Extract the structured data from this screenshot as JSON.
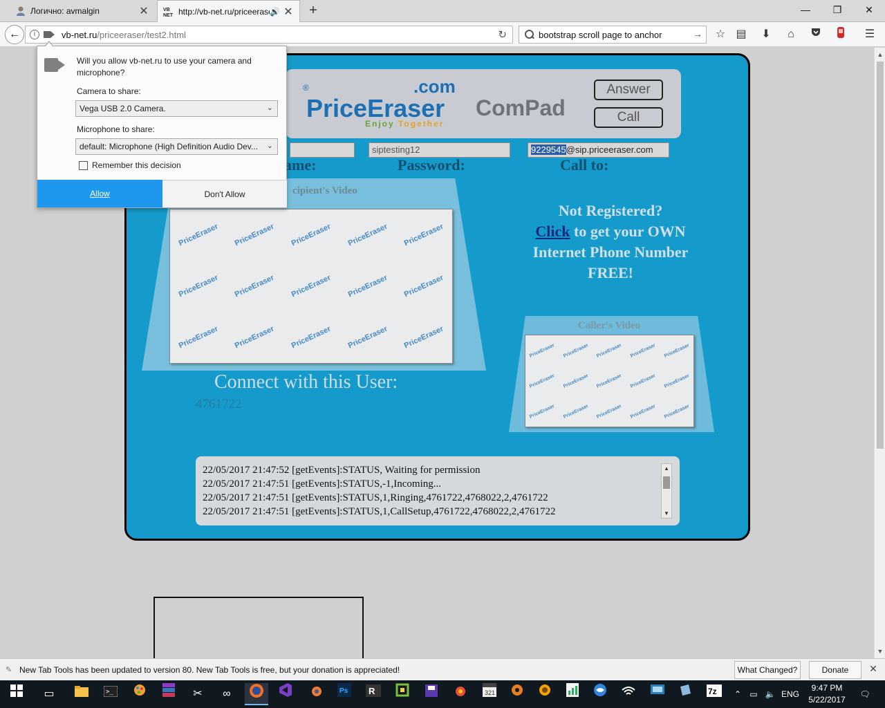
{
  "browser": {
    "tabs": [
      {
        "title": "Логично: avmalgin",
        "favicon": "user-icon"
      },
      {
        "title": "http://vb-net.ru/priceeraser",
        "favicon": "vb-net-icon",
        "audio": "speaker-icon"
      }
    ],
    "url_domain": "vb-net.ru",
    "url_path": "/priceeraser/test2.html",
    "search_query": "bootstrap scroll page to anchor",
    "window_controls": {
      "minimize": "—",
      "restore": "❐",
      "close": "✕"
    }
  },
  "page": {
    "logo": {
      "registered": "®",
      "brand": "PriceEraser",
      "com": ".com",
      "tagline_1": "Enjoy",
      "tagline_2": "Together"
    },
    "compad": "ComPad",
    "answer_label": "Answer",
    "call_label": "Call",
    "password_value": "siptesting12",
    "call_to_selected": "9229545",
    "call_to_rest": "@sip.priceeraser.com",
    "label_username": "ame:",
    "label_password": "Password:",
    "label_callto": "Call to:",
    "recipient_video_label": "cipient's Video",
    "caller_video_label": "Caller's Video",
    "video_watermark": "PriceEraser",
    "connect_label": "Connect with this User:",
    "connect_number": "4761722",
    "promo": {
      "line1": "Not Registered?",
      "link": "Click",
      "line2": " to get your OWN",
      "line3": "Internet Phone Number",
      "line4": "FREE!"
    },
    "log_lines": [
      "22/05/2017 21:47:52 [getEvents]:STATUS, Waiting for permission",
      "22/05/2017 21:47:51 [getEvents]:STATUS,-1,Incoming...",
      "22/05/2017 21:47:51 [getEvents]:STATUS,1,Ringing,4761722,4768022,2,4761722",
      "22/05/2017 21:47:51 [getEvents]:STATUS,1,CallSetup,4761722,4768022,2,4761722"
    ]
  },
  "permission": {
    "question": "Will you allow vb-net.ru to use your camera and microphone?",
    "camera_label": "Camera to share:",
    "camera_value": "Vega USB 2.0 Camera.",
    "mic_label": "Microphone to share:",
    "mic_value": "default: Microphone (High Definition Audio Dev...",
    "remember": "Remember this decision",
    "allow": "Allow",
    "deny": "Don't Allow"
  },
  "notification": {
    "text": "New Tab Tools has been updated to version 80. New Tab Tools is free, but your donation is appreciated!",
    "what_changed": "What Changed?",
    "donate": "Donate"
  },
  "taskbar": {
    "language": "ENG",
    "time": "9:47 PM",
    "date": "5/22/2017"
  },
  "colors": {
    "phone_bg": "#159bcb",
    "allow_button": "#1e97ef",
    "taskbar": "#101820"
  }
}
